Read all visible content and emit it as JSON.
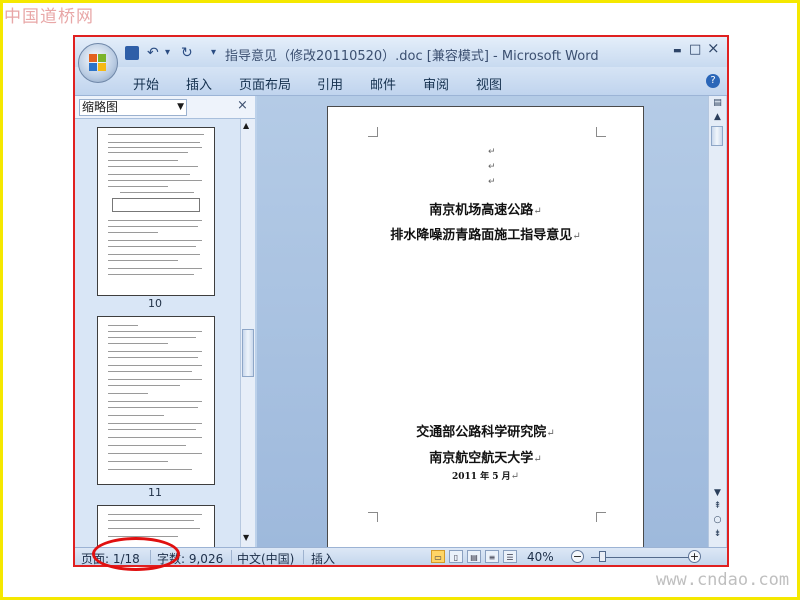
{
  "watermarks": {
    "top_left": "中国道桥网",
    "bottom_right": "www.cndao.com"
  },
  "window": {
    "title": "指导意见（修改20110520）.doc [兼容模式] - Microsoft Word",
    "minimize": "▬",
    "maximize": "□",
    "close": "×"
  },
  "quick_access": {
    "save_icon": "save-icon",
    "undo": "↶",
    "redo": "↻",
    "dropdown": "▾"
  },
  "ribbon": {
    "tabs": [
      "开始",
      "插入",
      "页面布局",
      "引用",
      "邮件",
      "审阅",
      "视图"
    ],
    "help": "?"
  },
  "nav_pane": {
    "view_select": "缩略图",
    "close": "×",
    "thumbnails": [
      {
        "page_number": "10"
      },
      {
        "page_number": "11"
      }
    ]
  },
  "document": {
    "title_line1": "南京机场高速公路",
    "title_line2": "排水降噪沥青路面施工指导意见",
    "org1": "交通部公路科学研究院",
    "org2": "南京航空航天大学",
    "date": "2011 年 5 月",
    "paragraph_mark": "↵"
  },
  "status_bar": {
    "page": "页面: 1/18",
    "words": "字数: 9,026",
    "language": "中文(中国)",
    "mode": "插入",
    "zoom": "40%",
    "zoom_minus": "−",
    "zoom_plus": "+"
  },
  "colors": {
    "highlight_ellipse": "#e01010",
    "window_border": "#e02020",
    "frame": "#f5e800"
  }
}
